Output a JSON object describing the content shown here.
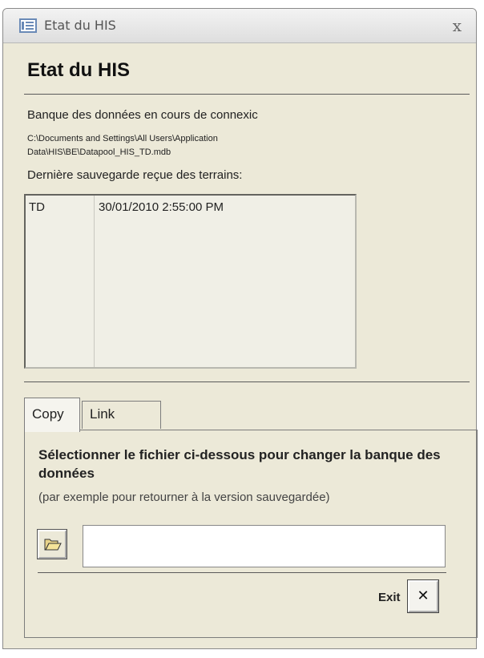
{
  "window": {
    "title": "Etat du HIS",
    "close_label": "x"
  },
  "header": {
    "title": "Etat du HIS"
  },
  "connection": {
    "label": "Banque des données en cours de connexic",
    "path": "C:\\Documents and Settings\\All Users\\Application Data\\HIS\\BE\\Datapool_HIS_TD.mdb"
  },
  "last_backup": {
    "label": "Dernière sauvegarde reçue des terrains:",
    "rows": [
      {
        "code": "TD",
        "date": "30/01/2010 2:55:00 PM"
      }
    ]
  },
  "tabs": [
    {
      "label": "Copy",
      "active": true
    },
    {
      "label": "Link",
      "active": false
    }
  ],
  "copy_panel": {
    "heading": "Sélectionner le fichier ci-dessous pour changer la banque des données",
    "subtext": "(par exemple pour retourner à la version sauvegardée)",
    "file_value": ""
  },
  "footer": {
    "exit_label": "Exit",
    "exit_button_glyph": "✕"
  },
  "colors": {
    "window_bg": "#ece9d8",
    "titlebar_icon": "#6a8ab7"
  },
  "icons": [
    "form-icon",
    "folder-open-icon",
    "close-icon"
  ]
}
